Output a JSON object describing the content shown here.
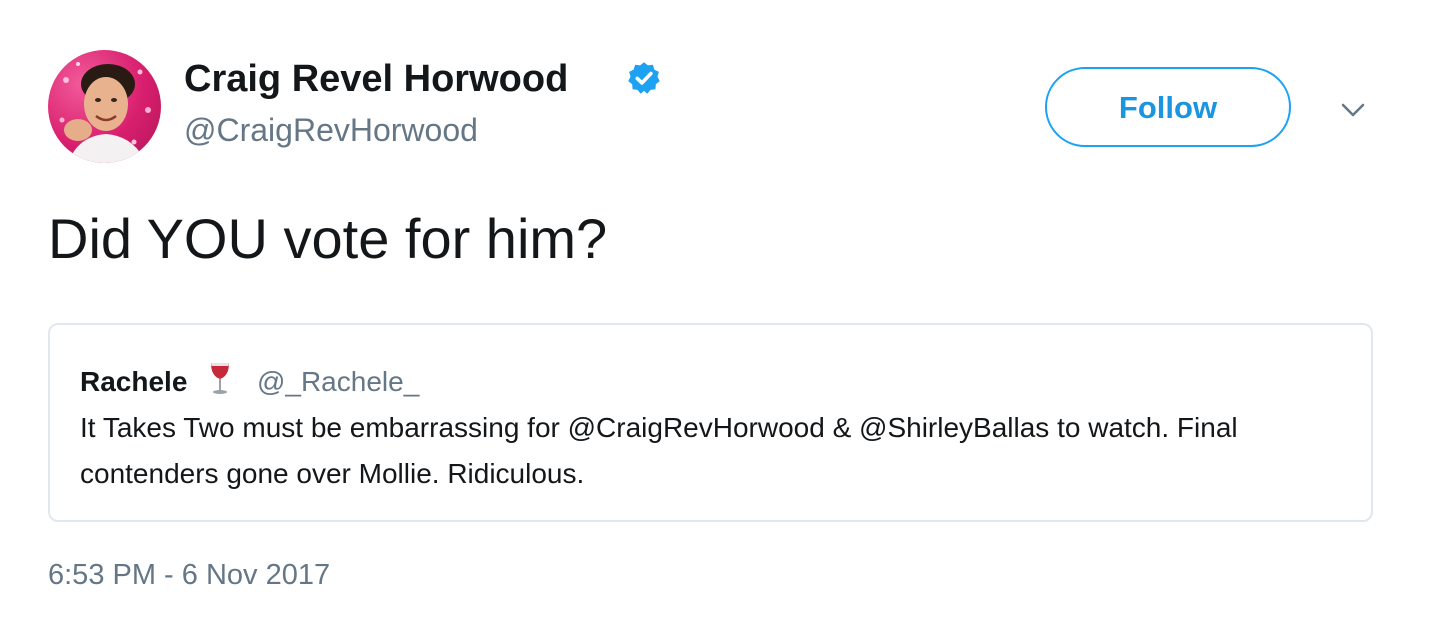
{
  "tweet": {
    "author": {
      "display_name": "Craig Revel Horwood",
      "handle": "@CraigRevHorwood",
      "verified": true,
      "avatar_icon": "profile-photo"
    },
    "follow_label": "Follow",
    "more_icon": "chevron-down-icon",
    "text": "Did YOU vote for him?",
    "quoted": {
      "display_name": "Rachele",
      "emoji": "🍷",
      "handle": "@_Rachele_",
      "text": "It Takes Two must be embarrassing for @CraigRevHorwood & @ShirleyBallas to watch. Final contenders gone over Mollie. Ridiculous."
    },
    "timestamp": "6:53 PM - 6 Nov 2017"
  },
  "colors": {
    "accent": "#1da1f2",
    "follow_text": "#1b95e0",
    "secondary_text": "#657786",
    "primary_text": "#14171a",
    "border": "#e1e8ed",
    "avatar_bg": "#d81f6e"
  }
}
